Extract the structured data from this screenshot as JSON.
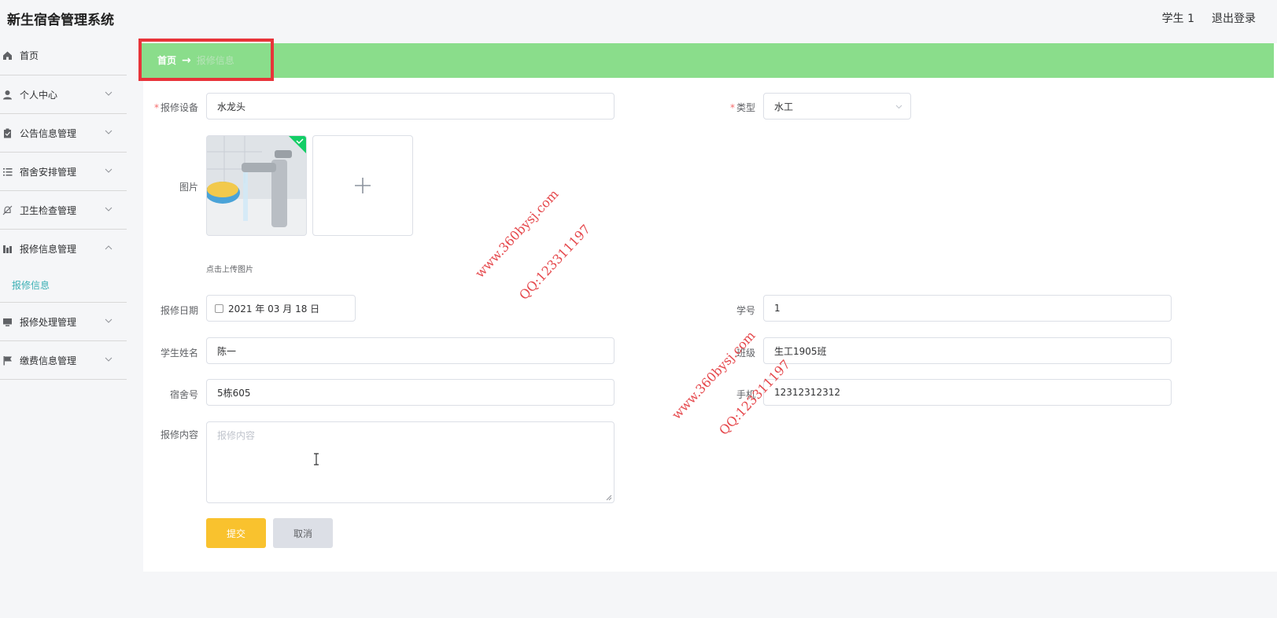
{
  "app": {
    "title": "新生宿舍管理系统"
  },
  "header": {
    "user": "学生 1",
    "logout": "退出登录"
  },
  "sidebar": {
    "items": [
      {
        "label": "首页",
        "icon": "home-icon"
      },
      {
        "label": "个人中心",
        "icon": "user-icon"
      },
      {
        "label": "公告信息管理",
        "icon": "clipboard-icon"
      },
      {
        "label": "宿舍安排管理",
        "icon": "list-icon"
      },
      {
        "label": "卫生检查管理",
        "icon": "bell-off-icon"
      },
      {
        "label": "报修信息管理",
        "icon": "chart-icon",
        "expanded": true,
        "children": [
          {
            "label": "报修信息",
            "active": true
          }
        ]
      },
      {
        "label": "报修处理管理",
        "icon": "monitor-icon"
      },
      {
        "label": "缴费信息管理",
        "icon": "flag-icon"
      }
    ]
  },
  "breadcrumb": {
    "home": "首页",
    "arrow": "→",
    "current": "报修信息"
  },
  "form": {
    "device": {
      "label": "报修设备",
      "value": "水龙头",
      "required": true
    },
    "type": {
      "label": "类型",
      "value": "水工",
      "required": true
    },
    "image": {
      "label": "图片",
      "upload_plus": "+",
      "tip": "点击上传图片"
    },
    "date": {
      "label": "报修日期",
      "value": "2021 年 03 月 18 日"
    },
    "student_no": {
      "label": "学号",
      "value": "1"
    },
    "student_name": {
      "label": "学生姓名",
      "value": "陈一"
    },
    "class": {
      "label": "班级",
      "value": "生工1905班"
    },
    "dorm": {
      "label": "宿舍号",
      "value": "5栋605"
    },
    "phone": {
      "label": "手机",
      "value": "12312312312"
    },
    "content": {
      "label": "报修内容",
      "placeholder": "报修内容"
    },
    "submit": "提交",
    "cancel": "取消"
  },
  "watermarks": [
    {
      "site": "www.360bysj.com",
      "qq": "QQ:123311197"
    },
    {
      "site": "www.360bysj.com",
      "qq": "QQ:123311197"
    }
  ],
  "colors": {
    "breadcrumb_bg": "#8add8b",
    "highlight_border": "#e8343a",
    "submit_bg": "#f9c22e",
    "active_menu": "#3cb0b5"
  }
}
